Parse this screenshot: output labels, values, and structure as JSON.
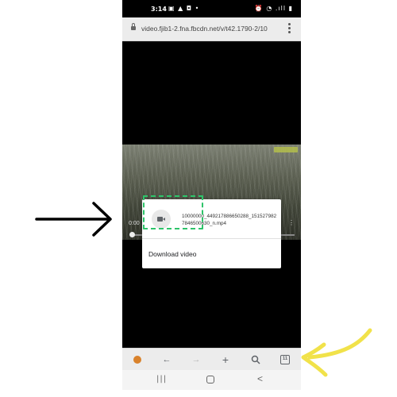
{
  "status_bar": {
    "time": "3:14",
    "left_icons": "▣ ▲ ◘ •",
    "right_icons": "⏰ ◔ .ıll ▮"
  },
  "url_bar": {
    "url": "video.fjib1-2.fna.fbcdn.net/v/t42.1790-2/10",
    "icons": [
      "lock-icon",
      "menu-icon"
    ]
  },
  "video": {
    "time": "0:00",
    "more": "⋮",
    "progress": 0
  },
  "dialog": {
    "file_name": "10000000_449217886650288_1515279827846500630_n.mp4",
    "option_label": "Download video"
  },
  "browser_toolbar": {
    "back": "←",
    "forward": "→",
    "new_tab": "+",
    "search": "🔍",
    "tab_count": "11"
  },
  "android_nav": {
    "recents": "|||",
    "back": "<"
  },
  "colors": {
    "highlight": "#2ec46a",
    "arrow_black": "#000000",
    "arrow_yellow": "#f1e24a"
  }
}
